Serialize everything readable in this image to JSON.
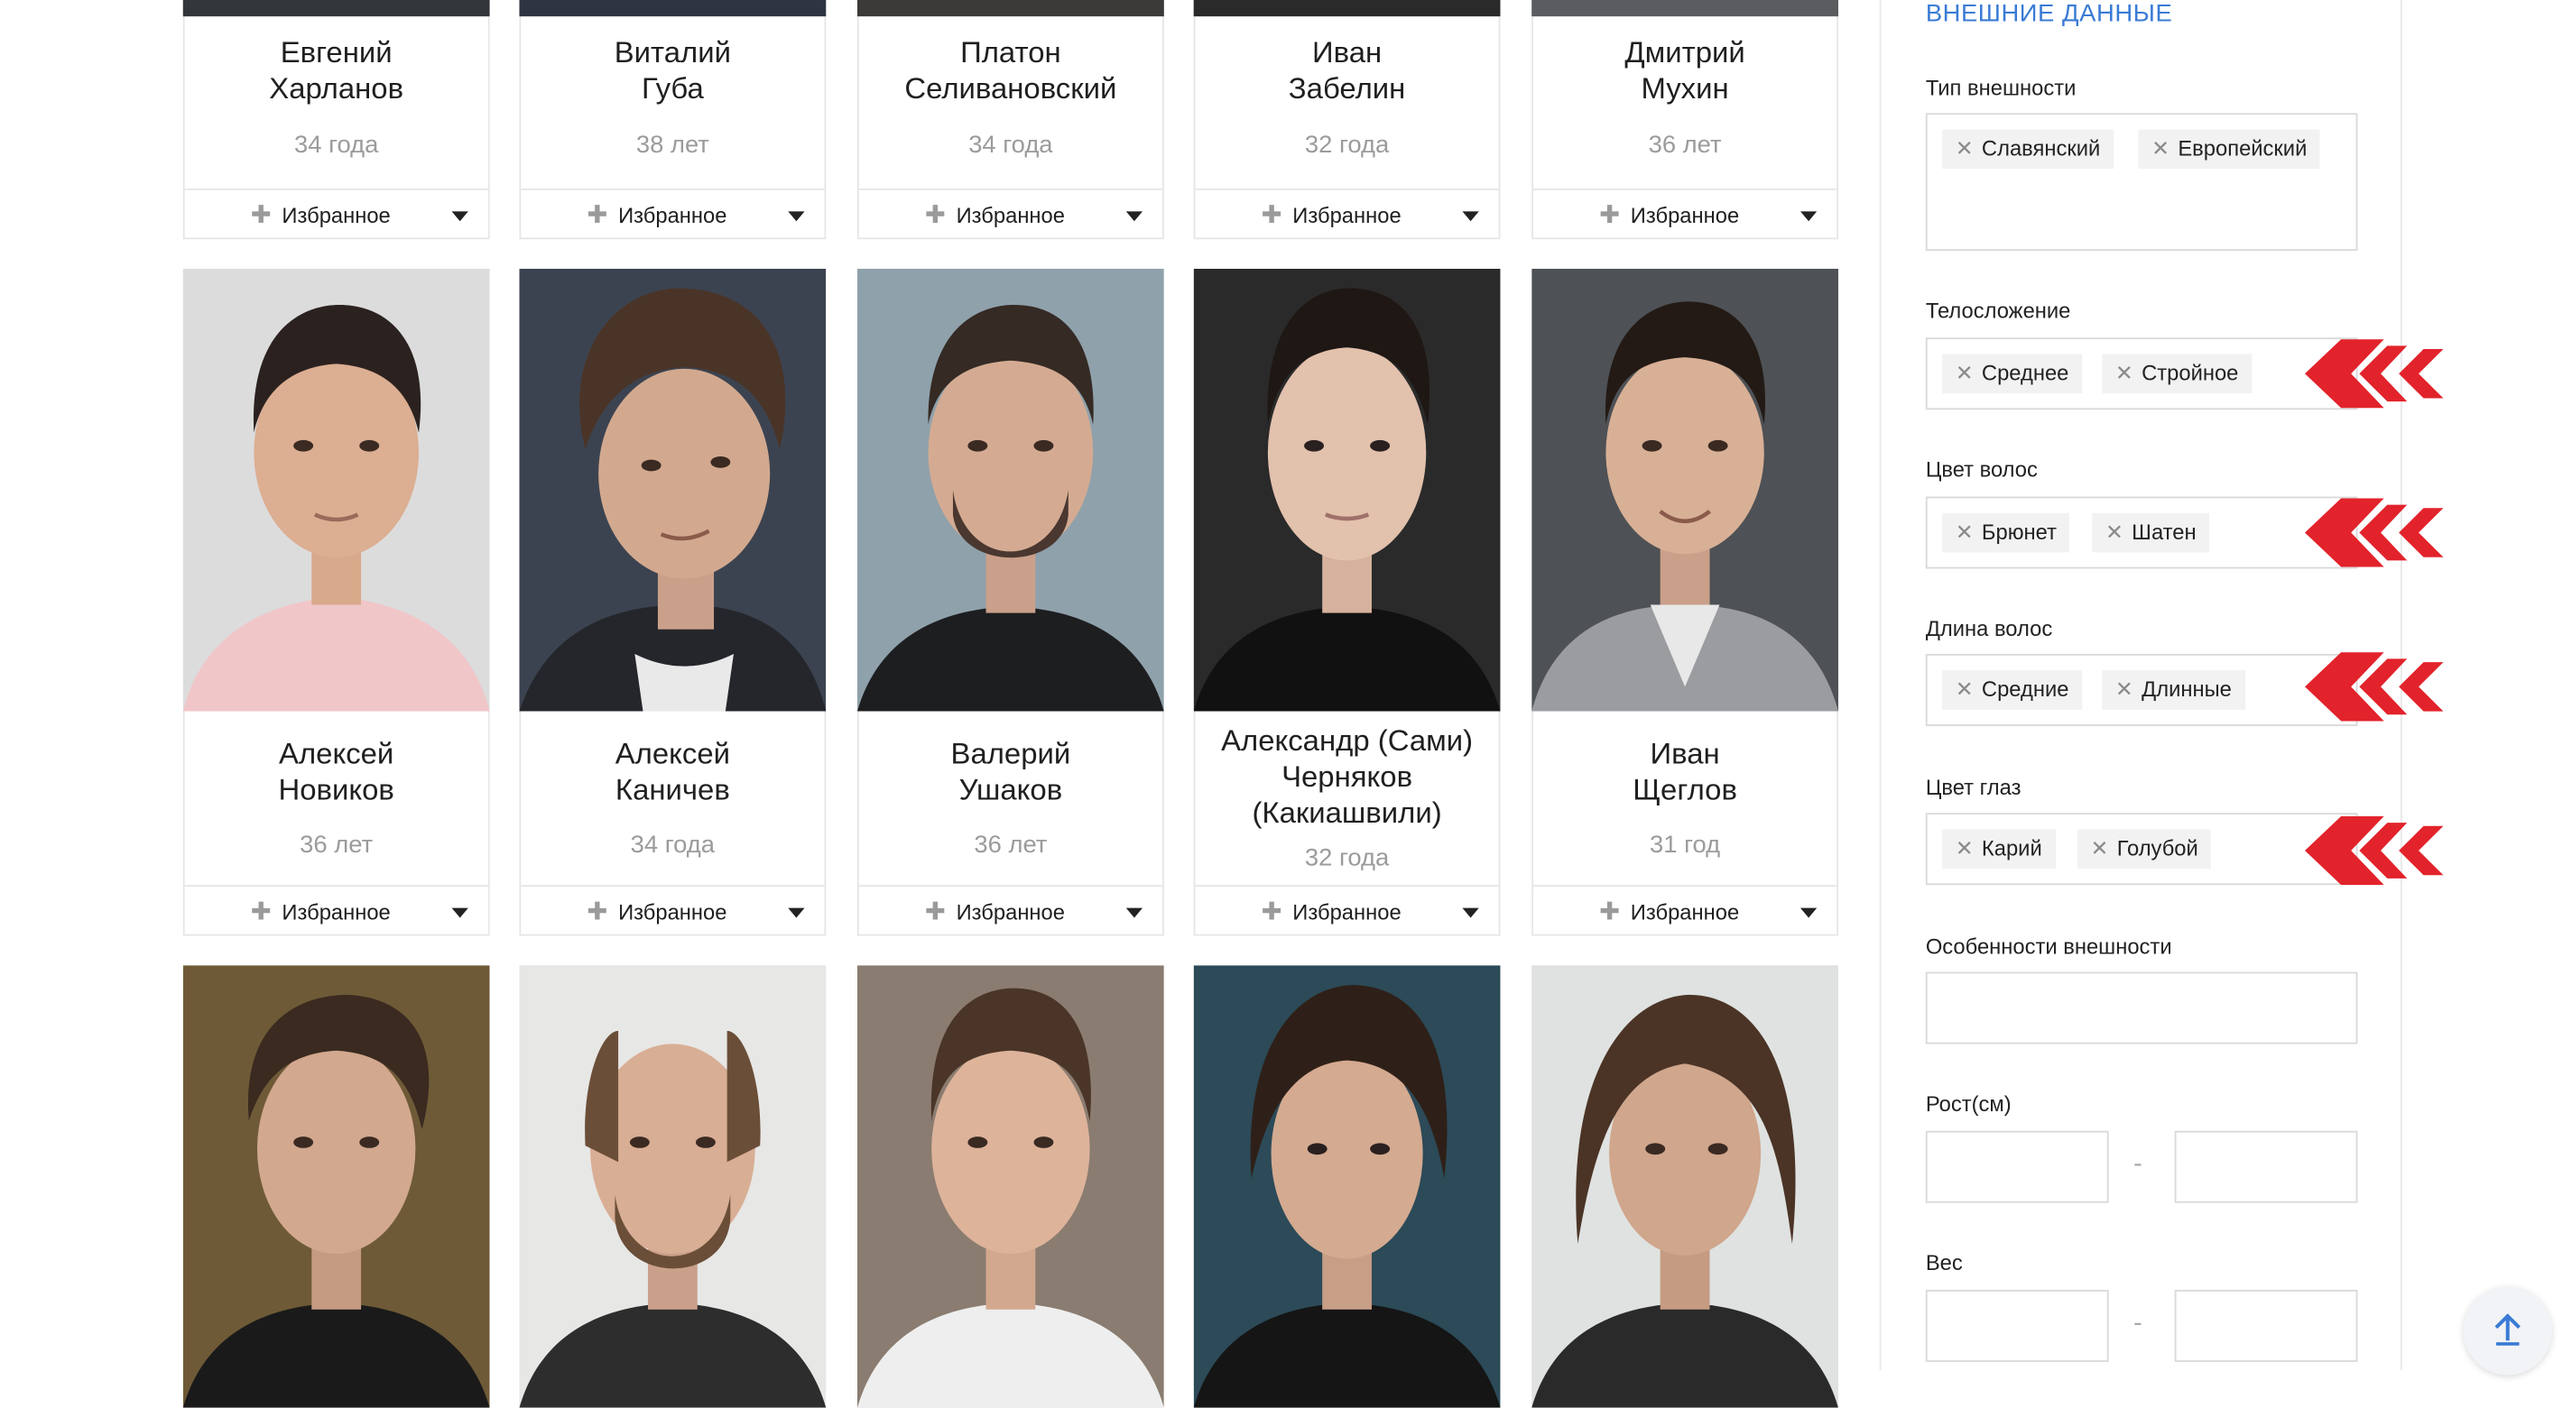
{
  "colors": {
    "accent": "#3a7bd5",
    "arrow": "#e2232b",
    "tag_bg": "#f2f2f2",
    "muted_text": "#9b9b9b"
  },
  "favorite_label": "Избранное",
  "grid": {
    "row1": [
      {
        "first": "Евгений",
        "last": "Харланов",
        "age": "34 года"
      },
      {
        "first": "Виталий",
        "last": "Губа",
        "age": "38 лет"
      },
      {
        "first": "Платон",
        "last": "Селивановский",
        "age": "34 года"
      },
      {
        "first": "Иван",
        "last": "Забелин",
        "age": "32 года"
      },
      {
        "first": "Дмитрий",
        "last": "Мухин",
        "age": "36 лет"
      }
    ],
    "row2": [
      {
        "first": "Алексей",
        "last": "Новиков",
        "age": "36 лет"
      },
      {
        "first": "Алексей",
        "last": "Каничев",
        "age": "34 года"
      },
      {
        "first": "Валерий",
        "last": "Ушаков",
        "age": "36 лет"
      },
      {
        "first": "Александр (Сами)",
        "last": "Черняков",
        "extra": "(Какиашвили)",
        "age": "32 года"
      },
      {
        "first": "Иван",
        "last": "Щеглов",
        "age": "31 год"
      }
    ]
  },
  "sidebar": {
    "section_title": "ВНЕШНИЕ ДАННЫЕ",
    "appearance_type": {
      "label": "Тип внешности",
      "tags": [
        "Славянский",
        "Европейский"
      ]
    },
    "build": {
      "label": "Телосложение",
      "tags": [
        "Среднее",
        "Стройное"
      ]
    },
    "hair_color": {
      "label": "Цвет волос",
      "tags": [
        "Брюнет",
        "Шатен"
      ]
    },
    "hair_length": {
      "label": "Длина волос",
      "tags": [
        "Средние",
        "Длинные"
      ]
    },
    "eye_color": {
      "label": "Цвет глаз",
      "tags": [
        "Карий",
        "Голубой"
      ]
    },
    "features": {
      "label": "Особенности внешности",
      "value": ""
    },
    "height": {
      "label": "Рост(см)",
      "from": "",
      "to": "",
      "separator": "-"
    },
    "weight": {
      "label": "Вес",
      "from": "",
      "to": "",
      "separator": "-"
    }
  }
}
